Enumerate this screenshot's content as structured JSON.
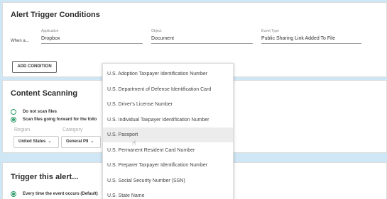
{
  "trigger": {
    "title": "Alert Trigger Conditions",
    "when_label": "When a...",
    "application": {
      "label": "Application",
      "value": "Dropbox"
    },
    "object": {
      "label": "Object",
      "value": "Document"
    },
    "event_type": {
      "label": "Event Type",
      "value": "Public Sharing Link Added To File"
    },
    "add_condition": "ADD CONDITION"
  },
  "content": {
    "title": "Content Scanning",
    "options": [
      "Do not scan files",
      "Scan files going forward for the follo"
    ],
    "selected_option": 1,
    "region_label": "Region",
    "region_value": "United States",
    "category_label": "Category",
    "category_value": "General PII"
  },
  "alert": {
    "title": "Trigger this alert...",
    "option": "Every time the event occurs (Default)"
  },
  "dropdown": {
    "items": [
      "U.S. Adoption Taxpayer Identification Number",
      "U.S. Department of Defense Identification Card",
      "U.S. Driver's License Number",
      "U.S. Individual Taxpayer Identification Number",
      "U.S. Passport",
      "U.S. Permanent Resident Card Number",
      "U.S. Preparer Taxpayer Identification Number",
      "U.S. Social Security Number (SSN)",
      "U.S. State Name"
    ],
    "highlighted_index": 4
  },
  "colors": {
    "accent": "#2e9a6a",
    "background": "#cfe6f4"
  },
  "icons": {
    "select_chevron": "chevron-down-icon",
    "cursor": "hand-pointer-icon"
  }
}
